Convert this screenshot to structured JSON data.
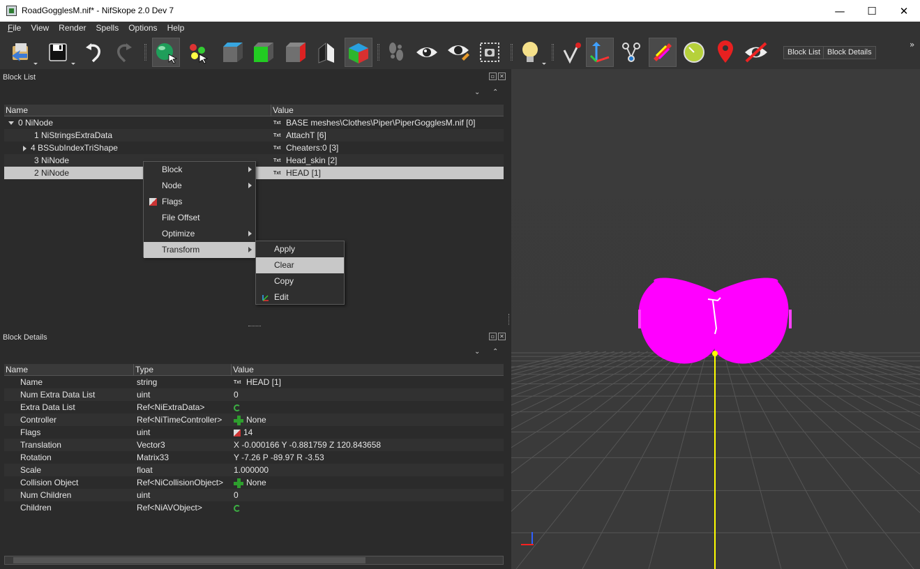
{
  "window": {
    "title": "RoadGogglesM.nif* - NifSkope 2.0 Dev 7",
    "min": "—",
    "max": "☐",
    "close": "✕"
  },
  "menu": [
    {
      "u": "F",
      "rest": "ile"
    },
    {
      "u": "",
      "rest": "View"
    },
    {
      "u": "",
      "rest": "Render"
    },
    {
      "u": "",
      "rest": "Spells"
    },
    {
      "u": "",
      "rest": "Options"
    },
    {
      "u": "",
      "rest": "Help"
    }
  ],
  "toolbar": {
    "block_list": "Block List",
    "block_details": "Block Details",
    "overflow": "»"
  },
  "block_list": {
    "title": "Block List",
    "columns": [
      "Name",
      "Value"
    ],
    "rows": [
      {
        "name": "0 NiNode",
        "value": "BASE meshes\\Clothes\\Piper\\PiperGogglesM.nif [0]"
      },
      {
        "name": "1 NiStringsExtraData",
        "value": "AttachT [6]"
      },
      {
        "name": "4 BSSubIndexTriShape",
        "value": "Cheaters:0 [3]"
      },
      {
        "name": "3 NiNode",
        "value": "Head_skin [2]"
      },
      {
        "name": "2 NiNode",
        "value": "HEAD [1]"
      }
    ],
    "txt_icon": "Txt"
  },
  "context_menu": {
    "items": [
      "Block",
      "Node",
      "Flags",
      "File Offset",
      "Optimize",
      "Transform"
    ],
    "submenu": [
      "Apply",
      "Clear",
      "Copy",
      "Edit"
    ]
  },
  "block_details": {
    "title": "Block Details",
    "columns": [
      "Name",
      "Type",
      "Value"
    ],
    "rows": [
      {
        "name": "Name",
        "type": "string",
        "value": "HEAD [1]"
      },
      {
        "name": "Num Extra Data List",
        "type": "uint",
        "value": "0"
      },
      {
        "name": "Extra Data List",
        "type": "Ref<NiExtraData>",
        "value": ""
      },
      {
        "name": "Controller",
        "type": "Ref<NiTimeController>",
        "value": "None"
      },
      {
        "name": "Flags",
        "type": "uint",
        "value": "14"
      },
      {
        "name": "Translation",
        "type": "Vector3",
        "value": "X -0.000166 Y -0.881759 Z 120.843658"
      },
      {
        "name": "Rotation",
        "type": "Matrix33",
        "value": "Y -7.26 P -89.97 R -3.53"
      },
      {
        "name": "Scale",
        "type": "float",
        "value": "1.000000"
      },
      {
        "name": "Collision Object",
        "type": "Ref<NiCollisionObject>",
        "value": "None"
      },
      {
        "name": "Num Children",
        "type": "uint",
        "value": "0"
      },
      {
        "name": "Children",
        "type": "Ref<NiAVObject>",
        "value": ""
      }
    ]
  },
  "colors": {
    "mesh": "#ff00ff",
    "axis": "#ffff00",
    "grid": "#555555"
  }
}
